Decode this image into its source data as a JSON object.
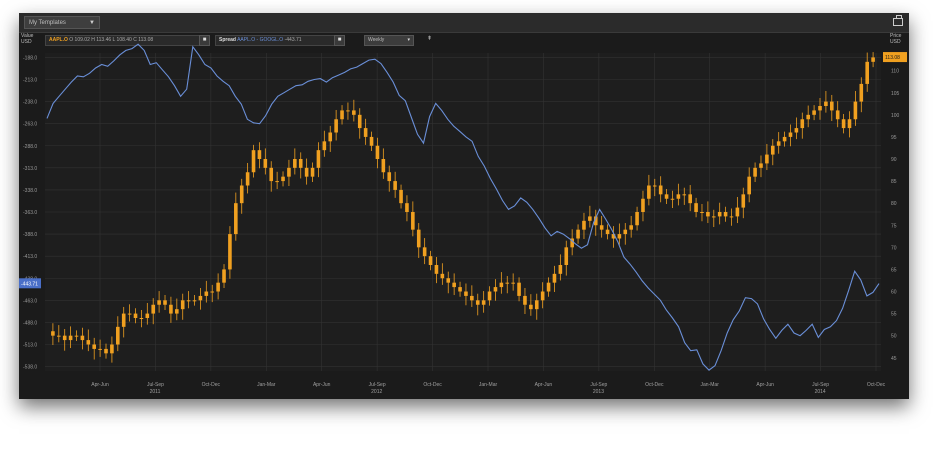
{
  "toolbar": {
    "template_label": "My Templates",
    "template_caret": "▼",
    "print_label": "print"
  },
  "legend": {
    "left_axis_title": "Value",
    "left_axis_unit": "USD",
    "right_axis_title": "Price",
    "right_axis_unit": "USD",
    "aapl_ticker": "AAPL.O",
    "aapl_values": "O 109.02  H 113.46  L 108.40  C 113.08",
    "spread_label": "Spread",
    "spread_tickers": "AAPL.O - GOOGL.O",
    "spread_value": "-443.71",
    "frequency": "Weekly",
    "chip_symbol": "■",
    "pin_symbol": "⇞"
  },
  "colors": {
    "background": "#1b1b1b",
    "candle": "#f0a020",
    "spread_line": "#6a8fd8",
    "grid": "#333333"
  },
  "chart_data": {
    "type": "line",
    "series": [
      {
        "name": "AAPL.O",
        "kind": "candlestick",
        "axis": "right",
        "values": [
          51,
          50,
          50,
          49,
          50,
          50,
          49,
          48,
          47,
          47,
          46,
          48,
          52,
          55,
          55,
          54,
          54,
          55,
          57,
          58,
          57,
          55,
          56,
          58,
          58,
          58,
          59,
          60,
          60,
          62,
          65,
          73,
          80,
          84,
          87,
          92,
          90,
          88,
          85,
          85,
          86,
          88,
          90,
          88,
          86,
          88,
          92,
          94,
          96,
          99,
          101,
          101,
          100,
          97,
          95,
          93,
          90,
          87,
          85,
          83,
          80,
          78,
          74,
          70,
          68,
          66,
          64,
          63,
          62,
          61,
          60,
          59,
          58,
          57,
          58,
          60,
          61,
          62,
          62,
          62,
          59,
          57,
          56,
          58,
          60,
          62,
          64,
          66,
          70,
          72,
          74,
          76,
          77,
          75,
          74,
          73,
          72,
          73,
          74,
          75,
          78,
          81,
          84,
          84,
          82,
          81,
          81,
          82,
          82,
          80,
          78,
          78,
          77,
          77,
          78,
          77,
          77,
          79,
          82,
          86,
          88,
          89,
          91,
          93,
          94,
          95,
          96,
          97,
          99,
          100,
          101,
          102,
          103,
          101,
          99,
          97,
          99,
          103,
          107,
          112,
          113
        ]
      },
      {
        "name": "AAPL.O - GOOGL.O",
        "kind": "line",
        "axis": "left",
        "values": [
          -257,
          -240,
          -232,
          -224,
          -216,
          -209,
          -210,
          -206,
          -200,
          -196,
          -198,
          -192,
          -185,
          -180,
          -178,
          -173,
          -180,
          -196,
          -194,
          -202,
          -210,
          -220,
          -232,
          -224,
          -176,
          -185,
          -196,
          -200,
          -209,
          -215,
          -220,
          -232,
          -241,
          -258,
          -262,
          -263,
          -254,
          -241,
          -232,
          -228,
          -224,
          -220,
          -219,
          -215,
          -213,
          -212,
          -216,
          -211,
          -208,
          -205,
          -201,
          -199,
          -195,
          -191,
          -190,
          -195,
          -205,
          -216,
          -231,
          -237,
          -256,
          -275,
          -285,
          -255,
          -240,
          -248,
          -258,
          -266,
          -272,
          -278,
          -283,
          -300,
          -311,
          -325,
          -337,
          -350,
          -360,
          -356,
          -347,
          -352,
          -360,
          -370,
          -381,
          -390,
          -385,
          -388,
          -393,
          -399,
          -404,
          -400,
          -375,
          -360,
          -371,
          -383,
          -397,
          -414,
          -422,
          -431,
          -441,
          -449,
          -456,
          -463,
          -474,
          -483,
          -493,
          -511,
          -520,
          -519,
          -535,
          -542,
          -537,
          -520,
          -500,
          -485,
          -475,
          -460,
          -461,
          -467,
          -484,
          -496,
          -506,
          -497,
          -490,
          -500,
          -503,
          -497,
          -490,
          -505,
          -496,
          -493,
          -486,
          -472,
          -452,
          -430,
          -440,
          -458,
          -454,
          -444
        ]
      }
    ],
    "x_tick_labels": [
      "Apr-Jun",
      "Jul-Sep",
      "Oct-Dec",
      "Jan-Mar",
      "Apr-Jun",
      "Jul-Sep",
      "Oct-Dec",
      "Jan-Mar",
      "Apr-Jun",
      "Jul-Sep",
      "Oct-Dec",
      "Jan-Mar",
      "Apr-Jun",
      "Jul-Sep",
      "Oct-Dec"
    ],
    "year_labels": [
      "2011",
      "2012",
      "2013",
      "2014"
    ],
    "left_ticks": [
      -188.0,
      -213.0,
      -238.0,
      -263.0,
      -288.0,
      -313.0,
      -338.0,
      -363.0,
      -388.0,
      -413.0,
      -438.0,
      -463.0,
      -488.0,
      -513.0,
      -538.0
    ],
    "right_ticks": [
      110,
      105,
      100,
      95,
      90,
      85,
      80,
      75,
      70,
      65,
      60,
      55,
      50,
      45
    ],
    "left_ylim": [
      -543,
      -183
    ],
    "right_ylim": [
      42,
      114
    ],
    "left_current": "-443.71",
    "right_current": "113.08",
    "grid": true
  }
}
